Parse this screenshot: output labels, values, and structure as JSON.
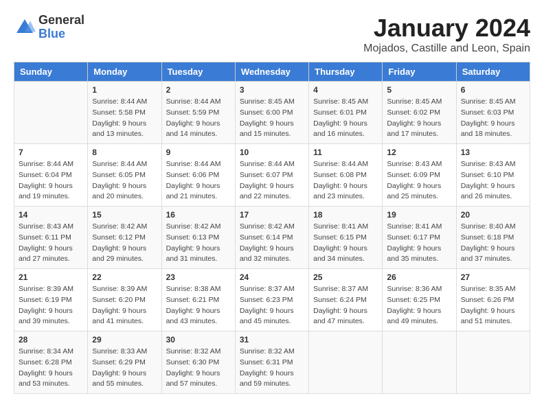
{
  "logo": {
    "general": "General",
    "blue": "Blue"
  },
  "header": {
    "month_year": "January 2024",
    "location": "Mojados, Castille and Leon, Spain"
  },
  "days_of_week": [
    "Sunday",
    "Monday",
    "Tuesday",
    "Wednesday",
    "Thursday",
    "Friday",
    "Saturday"
  ],
  "weeks": [
    [
      {
        "day": "",
        "info": ""
      },
      {
        "day": "1",
        "info": "Sunrise: 8:44 AM\nSunset: 5:58 PM\nDaylight: 9 hours\nand 13 minutes."
      },
      {
        "day": "2",
        "info": "Sunrise: 8:44 AM\nSunset: 5:59 PM\nDaylight: 9 hours\nand 14 minutes."
      },
      {
        "day": "3",
        "info": "Sunrise: 8:45 AM\nSunset: 6:00 PM\nDaylight: 9 hours\nand 15 minutes."
      },
      {
        "day": "4",
        "info": "Sunrise: 8:45 AM\nSunset: 6:01 PM\nDaylight: 9 hours\nand 16 minutes."
      },
      {
        "day": "5",
        "info": "Sunrise: 8:45 AM\nSunset: 6:02 PM\nDaylight: 9 hours\nand 17 minutes."
      },
      {
        "day": "6",
        "info": "Sunrise: 8:45 AM\nSunset: 6:03 PM\nDaylight: 9 hours\nand 18 minutes."
      }
    ],
    [
      {
        "day": "7",
        "info": "Sunrise: 8:44 AM\nSunset: 6:04 PM\nDaylight: 9 hours\nand 19 minutes."
      },
      {
        "day": "8",
        "info": "Sunrise: 8:44 AM\nSunset: 6:05 PM\nDaylight: 9 hours\nand 20 minutes."
      },
      {
        "day": "9",
        "info": "Sunrise: 8:44 AM\nSunset: 6:06 PM\nDaylight: 9 hours\nand 21 minutes."
      },
      {
        "day": "10",
        "info": "Sunrise: 8:44 AM\nSunset: 6:07 PM\nDaylight: 9 hours\nand 22 minutes."
      },
      {
        "day": "11",
        "info": "Sunrise: 8:44 AM\nSunset: 6:08 PM\nDaylight: 9 hours\nand 23 minutes."
      },
      {
        "day": "12",
        "info": "Sunrise: 8:43 AM\nSunset: 6:09 PM\nDaylight: 9 hours\nand 25 minutes."
      },
      {
        "day": "13",
        "info": "Sunrise: 8:43 AM\nSunset: 6:10 PM\nDaylight: 9 hours\nand 26 minutes."
      }
    ],
    [
      {
        "day": "14",
        "info": "Sunrise: 8:43 AM\nSunset: 6:11 PM\nDaylight: 9 hours\nand 27 minutes."
      },
      {
        "day": "15",
        "info": "Sunrise: 8:42 AM\nSunset: 6:12 PM\nDaylight: 9 hours\nand 29 minutes."
      },
      {
        "day": "16",
        "info": "Sunrise: 8:42 AM\nSunset: 6:13 PM\nDaylight: 9 hours\nand 31 minutes."
      },
      {
        "day": "17",
        "info": "Sunrise: 8:42 AM\nSunset: 6:14 PM\nDaylight: 9 hours\nand 32 minutes."
      },
      {
        "day": "18",
        "info": "Sunrise: 8:41 AM\nSunset: 6:15 PM\nDaylight: 9 hours\nand 34 minutes."
      },
      {
        "day": "19",
        "info": "Sunrise: 8:41 AM\nSunset: 6:17 PM\nDaylight: 9 hours\nand 35 minutes."
      },
      {
        "day": "20",
        "info": "Sunrise: 8:40 AM\nSunset: 6:18 PM\nDaylight: 9 hours\nand 37 minutes."
      }
    ],
    [
      {
        "day": "21",
        "info": "Sunrise: 8:39 AM\nSunset: 6:19 PM\nDaylight: 9 hours\nand 39 minutes."
      },
      {
        "day": "22",
        "info": "Sunrise: 8:39 AM\nSunset: 6:20 PM\nDaylight: 9 hours\nand 41 minutes."
      },
      {
        "day": "23",
        "info": "Sunrise: 8:38 AM\nSunset: 6:21 PM\nDaylight: 9 hours\nand 43 minutes."
      },
      {
        "day": "24",
        "info": "Sunrise: 8:37 AM\nSunset: 6:23 PM\nDaylight: 9 hours\nand 45 minutes."
      },
      {
        "day": "25",
        "info": "Sunrise: 8:37 AM\nSunset: 6:24 PM\nDaylight: 9 hours\nand 47 minutes."
      },
      {
        "day": "26",
        "info": "Sunrise: 8:36 AM\nSunset: 6:25 PM\nDaylight: 9 hours\nand 49 minutes."
      },
      {
        "day": "27",
        "info": "Sunrise: 8:35 AM\nSunset: 6:26 PM\nDaylight: 9 hours\nand 51 minutes."
      }
    ],
    [
      {
        "day": "28",
        "info": "Sunrise: 8:34 AM\nSunset: 6:28 PM\nDaylight: 9 hours\nand 53 minutes."
      },
      {
        "day": "29",
        "info": "Sunrise: 8:33 AM\nSunset: 6:29 PM\nDaylight: 9 hours\nand 55 minutes."
      },
      {
        "day": "30",
        "info": "Sunrise: 8:32 AM\nSunset: 6:30 PM\nDaylight: 9 hours\nand 57 minutes."
      },
      {
        "day": "31",
        "info": "Sunrise: 8:32 AM\nSunset: 6:31 PM\nDaylight: 9 hours\nand 59 minutes."
      },
      {
        "day": "",
        "info": ""
      },
      {
        "day": "",
        "info": ""
      },
      {
        "day": "",
        "info": ""
      }
    ]
  ]
}
